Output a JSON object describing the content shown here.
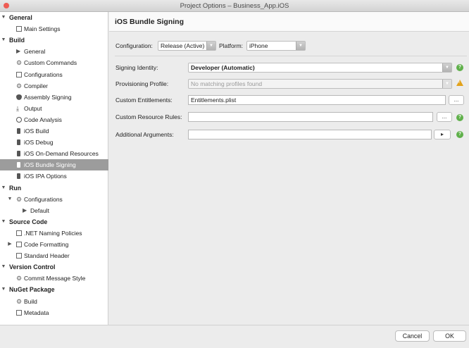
{
  "window": {
    "title": "Project Options – Business_App.iOS",
    "traffic_colors": [
      "#ee5c54",
      "#f8bd3b",
      "#62c554"
    ]
  },
  "sidebar": {
    "items": [
      {
        "label": "General",
        "kind": "category",
        "expanded": true,
        "icon": "none"
      },
      {
        "label": "Main Settings",
        "kind": "item",
        "icon": "doc-icon"
      },
      {
        "label": "Build",
        "kind": "category",
        "expanded": true,
        "icon": "none"
      },
      {
        "label": "General",
        "kind": "item",
        "icon": "play-icon"
      },
      {
        "label": "Custom Commands",
        "kind": "item",
        "icon": "gear-icon"
      },
      {
        "label": "Configurations",
        "kind": "item",
        "icon": "doc-icon"
      },
      {
        "label": "Compiler",
        "kind": "item",
        "icon": "gear-icon"
      },
      {
        "label": "Assembly Signing",
        "kind": "item",
        "icon": "shield-icon"
      },
      {
        "label": "Output",
        "kind": "item",
        "icon": "download-icon"
      },
      {
        "label": "Code Analysis",
        "kind": "item",
        "icon": "circle-icon"
      },
      {
        "label": "iOS Build",
        "kind": "item",
        "icon": "device-icon"
      },
      {
        "label": "iOS Debug",
        "kind": "item",
        "icon": "device-icon"
      },
      {
        "label": "iOS On-Demand Resources",
        "kind": "item",
        "icon": "device-icon"
      },
      {
        "label": "iOS Bundle Signing",
        "kind": "item",
        "icon": "device-icon",
        "selected": true
      },
      {
        "label": "iOS IPA Options",
        "kind": "item",
        "icon": "device-icon"
      },
      {
        "label": "Run",
        "kind": "category",
        "expanded": true,
        "icon": "none"
      },
      {
        "label": "Configurations",
        "kind": "subcategory",
        "expanded": true,
        "icon": "gear-icon"
      },
      {
        "label": "Default",
        "kind": "subitem",
        "icon": "play-icon"
      },
      {
        "label": "Source Code",
        "kind": "category",
        "expanded": true,
        "icon": "none"
      },
      {
        "label": ".NET Naming Policies",
        "kind": "item",
        "icon": "grid-icon"
      },
      {
        "label": "Code Formatting",
        "kind": "subcategory",
        "expanded": false,
        "icon": "doc-icon"
      },
      {
        "label": "Standard Header",
        "kind": "item",
        "icon": "doc-icon"
      },
      {
        "label": "Version Control",
        "kind": "category",
        "expanded": true,
        "icon": "none"
      },
      {
        "label": "Commit Message Style",
        "kind": "item",
        "icon": "gear-icon"
      },
      {
        "label": "NuGet Package",
        "kind": "category",
        "expanded": true,
        "icon": "none"
      },
      {
        "label": "Build",
        "kind": "item",
        "icon": "gear-icon"
      },
      {
        "label": "Metadata",
        "kind": "item",
        "icon": "doc-icon"
      }
    ]
  },
  "main": {
    "title": "iOS Bundle Signing",
    "configuration_label": "Configuration:",
    "configuration_value": "Release (Active)",
    "platform_label": "Platform:",
    "platform_value": "iPhone",
    "signing_identity_label": "Signing Identity:",
    "signing_identity_value": "Developer (Automatic)",
    "provisioning_profile_label": "Provisioning Profile:",
    "provisioning_profile_value": "No matching profiles found",
    "custom_entitlements_label": "Custom Entitlements:",
    "custom_entitlements_value": "Entitlements.plist",
    "custom_resource_rules_label": "Custom Resource Rules:",
    "custom_resource_rules_value": "",
    "additional_arguments_label": "Additional Arguments:",
    "additional_arguments_value": "",
    "browse_label": "...",
    "run_label": "▸",
    "help_glyph": "?",
    "warn_glyph": "!"
  },
  "footer": {
    "cancel_label": "Cancel",
    "ok_label": "OK"
  },
  "colors": {
    "selected_row": "#9c9c9c",
    "help": "#5fb04a",
    "warning": "#e2a21b"
  }
}
